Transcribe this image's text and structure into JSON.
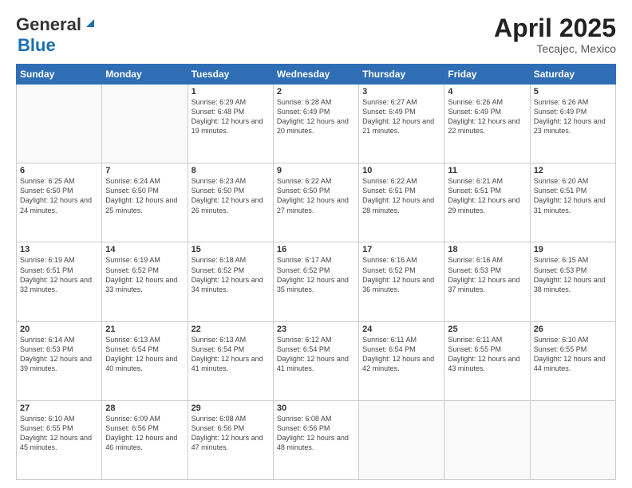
{
  "header": {
    "logo_general": "General",
    "logo_blue": "Blue",
    "month_year": "April 2025",
    "location": "Tecajec, Mexico"
  },
  "days_of_week": [
    "Sunday",
    "Monday",
    "Tuesday",
    "Wednesday",
    "Thursday",
    "Friday",
    "Saturday"
  ],
  "weeks": [
    [
      {
        "day": "",
        "sunrise": "",
        "sunset": "",
        "daylight": ""
      },
      {
        "day": "",
        "sunrise": "",
        "sunset": "",
        "daylight": ""
      },
      {
        "day": "1",
        "sunrise": "Sunrise: 6:29 AM",
        "sunset": "Sunset: 6:48 PM",
        "daylight": "Daylight: 12 hours and 19 minutes."
      },
      {
        "day": "2",
        "sunrise": "Sunrise: 6:28 AM",
        "sunset": "Sunset: 6:49 PM",
        "daylight": "Daylight: 12 hours and 20 minutes."
      },
      {
        "day": "3",
        "sunrise": "Sunrise: 6:27 AM",
        "sunset": "Sunset: 6:49 PM",
        "daylight": "Daylight: 12 hours and 21 minutes."
      },
      {
        "day": "4",
        "sunrise": "Sunrise: 6:26 AM",
        "sunset": "Sunset: 6:49 PM",
        "daylight": "Daylight: 12 hours and 22 minutes."
      },
      {
        "day": "5",
        "sunrise": "Sunrise: 6:26 AM",
        "sunset": "Sunset: 6:49 PM",
        "daylight": "Daylight: 12 hours and 23 minutes."
      }
    ],
    [
      {
        "day": "6",
        "sunrise": "Sunrise: 6:25 AM",
        "sunset": "Sunset: 6:50 PM",
        "daylight": "Daylight: 12 hours and 24 minutes."
      },
      {
        "day": "7",
        "sunrise": "Sunrise: 6:24 AM",
        "sunset": "Sunset: 6:50 PM",
        "daylight": "Daylight: 12 hours and 25 minutes."
      },
      {
        "day": "8",
        "sunrise": "Sunrise: 6:23 AM",
        "sunset": "Sunset: 6:50 PM",
        "daylight": "Daylight: 12 hours and 26 minutes."
      },
      {
        "day": "9",
        "sunrise": "Sunrise: 6:22 AM",
        "sunset": "Sunset: 6:50 PM",
        "daylight": "Daylight: 12 hours and 27 minutes."
      },
      {
        "day": "10",
        "sunrise": "Sunrise: 6:22 AM",
        "sunset": "Sunset: 6:51 PM",
        "daylight": "Daylight: 12 hours and 28 minutes."
      },
      {
        "day": "11",
        "sunrise": "Sunrise: 6:21 AM",
        "sunset": "Sunset: 6:51 PM",
        "daylight": "Daylight: 12 hours and 29 minutes."
      },
      {
        "day": "12",
        "sunrise": "Sunrise: 6:20 AM",
        "sunset": "Sunset: 6:51 PM",
        "daylight": "Daylight: 12 hours and 31 minutes."
      }
    ],
    [
      {
        "day": "13",
        "sunrise": "Sunrise: 6:19 AM",
        "sunset": "Sunset: 6:51 PM",
        "daylight": "Daylight: 12 hours and 32 minutes."
      },
      {
        "day": "14",
        "sunrise": "Sunrise: 6:19 AM",
        "sunset": "Sunset: 6:52 PM",
        "daylight": "Daylight: 12 hours and 33 minutes."
      },
      {
        "day": "15",
        "sunrise": "Sunrise: 6:18 AM",
        "sunset": "Sunset: 6:52 PM",
        "daylight": "Daylight: 12 hours and 34 minutes."
      },
      {
        "day": "16",
        "sunrise": "Sunrise: 6:17 AM",
        "sunset": "Sunset: 6:52 PM",
        "daylight": "Daylight: 12 hours and 35 minutes."
      },
      {
        "day": "17",
        "sunrise": "Sunrise: 6:16 AM",
        "sunset": "Sunset: 6:52 PM",
        "daylight": "Daylight: 12 hours and 36 minutes."
      },
      {
        "day": "18",
        "sunrise": "Sunrise: 6:16 AM",
        "sunset": "Sunset: 6:53 PM",
        "daylight": "Daylight: 12 hours and 37 minutes."
      },
      {
        "day": "19",
        "sunrise": "Sunrise: 6:15 AM",
        "sunset": "Sunset: 6:53 PM",
        "daylight": "Daylight: 12 hours and 38 minutes."
      }
    ],
    [
      {
        "day": "20",
        "sunrise": "Sunrise: 6:14 AM",
        "sunset": "Sunset: 6:53 PM",
        "daylight": "Daylight: 12 hours and 39 minutes."
      },
      {
        "day": "21",
        "sunrise": "Sunrise: 6:13 AM",
        "sunset": "Sunset: 6:54 PM",
        "daylight": "Daylight: 12 hours and 40 minutes."
      },
      {
        "day": "22",
        "sunrise": "Sunrise: 6:13 AM",
        "sunset": "Sunset: 6:54 PM",
        "daylight": "Daylight: 12 hours and 41 minutes."
      },
      {
        "day": "23",
        "sunrise": "Sunrise: 6:12 AM",
        "sunset": "Sunset: 6:54 PM",
        "daylight": "Daylight: 12 hours and 41 minutes."
      },
      {
        "day": "24",
        "sunrise": "Sunrise: 6:11 AM",
        "sunset": "Sunset: 6:54 PM",
        "daylight": "Daylight: 12 hours and 42 minutes."
      },
      {
        "day": "25",
        "sunrise": "Sunrise: 6:11 AM",
        "sunset": "Sunset: 6:55 PM",
        "daylight": "Daylight: 12 hours and 43 minutes."
      },
      {
        "day": "26",
        "sunrise": "Sunrise: 6:10 AM",
        "sunset": "Sunset: 6:55 PM",
        "daylight": "Daylight: 12 hours and 44 minutes."
      }
    ],
    [
      {
        "day": "27",
        "sunrise": "Sunrise: 6:10 AM",
        "sunset": "Sunset: 6:55 PM",
        "daylight": "Daylight: 12 hours and 45 minutes."
      },
      {
        "day": "28",
        "sunrise": "Sunrise: 6:09 AM",
        "sunset": "Sunset: 6:56 PM",
        "daylight": "Daylight: 12 hours and 46 minutes."
      },
      {
        "day": "29",
        "sunrise": "Sunrise: 6:08 AM",
        "sunset": "Sunset: 6:56 PM",
        "daylight": "Daylight: 12 hours and 47 minutes."
      },
      {
        "day": "30",
        "sunrise": "Sunrise: 6:08 AM",
        "sunset": "Sunset: 6:56 PM",
        "daylight": "Daylight: 12 hours and 48 minutes."
      },
      {
        "day": "",
        "sunrise": "",
        "sunset": "",
        "daylight": ""
      },
      {
        "day": "",
        "sunrise": "",
        "sunset": "",
        "daylight": ""
      },
      {
        "day": "",
        "sunrise": "",
        "sunset": "",
        "daylight": ""
      }
    ]
  ]
}
